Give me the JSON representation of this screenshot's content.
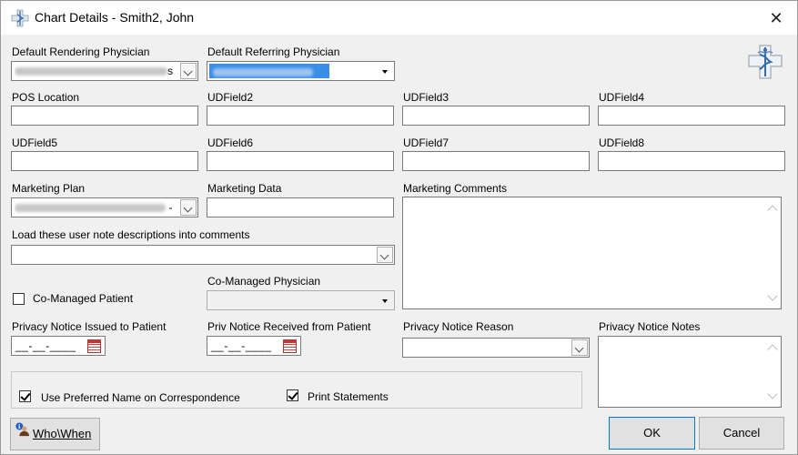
{
  "window": {
    "title": "Chart Details - Smith2, John"
  },
  "fields": {
    "default_rendering_physician": {
      "label": "Default Rendering Physician",
      "value_suffix": "s"
    },
    "default_referring_physician": {
      "label": "Default Referring Physician"
    },
    "pos_location": {
      "label": "POS Location",
      "value": ""
    },
    "udfield2": {
      "label": "UDField2",
      "value": ""
    },
    "udfield3": {
      "label": "UDField3",
      "value": ""
    },
    "udfield4": {
      "label": "UDField4",
      "value": ""
    },
    "udfield5": {
      "label": "UDField5",
      "value": ""
    },
    "udfield6": {
      "label": "UDField6",
      "value": ""
    },
    "udfield7": {
      "label": "UDField7",
      "value": ""
    },
    "udfield8": {
      "label": "UDField8",
      "value": ""
    },
    "marketing_plan": {
      "label": "Marketing Plan",
      "value_suffix": "-"
    },
    "marketing_data": {
      "label": "Marketing Data",
      "value": ""
    },
    "marketing_comments": {
      "label": "Marketing Comments",
      "value": ""
    },
    "user_note_descriptions": {
      "label": "Load these user note descriptions into comments",
      "value": ""
    },
    "co_managed_patient": {
      "label": "Co-Managed Patient",
      "checked": false
    },
    "co_managed_physician": {
      "label": "Co-Managed Physician",
      "value": ""
    },
    "privacy_notice_issued": {
      "label": "Privacy Notice Issued to Patient",
      "value": "__-__-____"
    },
    "priv_notice_received": {
      "label": "Priv Notice Received from Patient",
      "value": "__-__-____"
    },
    "privacy_notice_reason": {
      "label": "Privacy Notice Reason",
      "value": ""
    },
    "privacy_notice_notes": {
      "label": "Privacy Notice Notes",
      "value": ""
    },
    "use_preferred_name": {
      "label": "Use Preferred Name on Correspondence",
      "checked": true
    },
    "print_statements": {
      "label": "Print Statements",
      "checked": true
    }
  },
  "buttons": {
    "who_when": "Who\\When",
    "ok": "OK",
    "cancel": "Cancel"
  },
  "colors": {
    "selection_highlight": "#3a8ee6",
    "focus_border": "#0078d7"
  },
  "icons": [
    "medical-caduceus-icon",
    "close-icon",
    "calendar-icon",
    "chevron-down-icon",
    "info-person-icon"
  ]
}
